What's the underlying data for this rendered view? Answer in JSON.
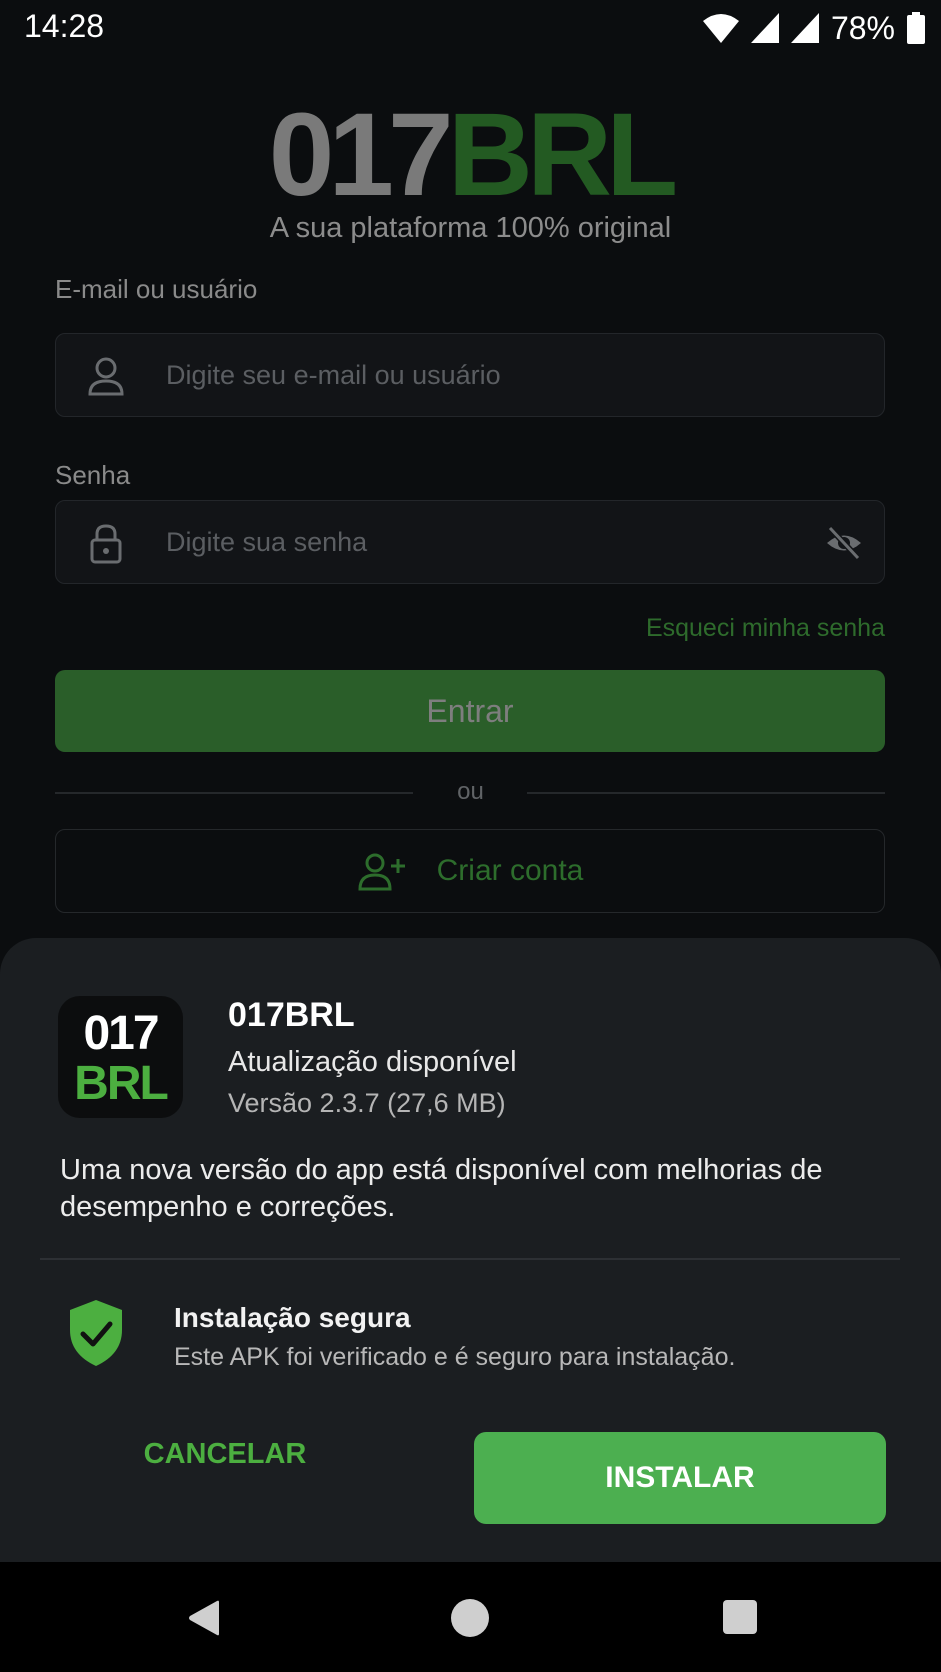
{
  "status_bar": {
    "time": "14:28",
    "battery": "78%"
  },
  "login": {
    "logo_number": "017",
    "logo_brand": "BRL",
    "tagline": "A sua plataforma 100% original",
    "email_label": "E-mail ou usuário",
    "email_placeholder": "Digite seu e-mail ou usuário",
    "password_label": "Senha",
    "password_placeholder": "Digite sua senha",
    "forgot_password": "Esqueci minha senha",
    "login_button": "Entrar",
    "or_text": "ou",
    "create_account": "Criar conta"
  },
  "update_sheet": {
    "icon_number": "017",
    "icon_brand": "BRL",
    "app_name": "017BRL",
    "subtitle": "Atualização disponível",
    "version": "Versão 2.3.7 (27,6 MB)",
    "description": "Uma nova versão do app está disponível com melhorias de desempenho e correções.",
    "secure_title": "Instalação segura",
    "secure_description": "Este APK foi verificado e é seguro para instalação.",
    "cancel_button": "CANCELAR",
    "install_button": "INSTALAR"
  },
  "colors": {
    "accent_green": "#4caf50",
    "background": "#0b0d0f",
    "sheet": "#1b1e21"
  }
}
